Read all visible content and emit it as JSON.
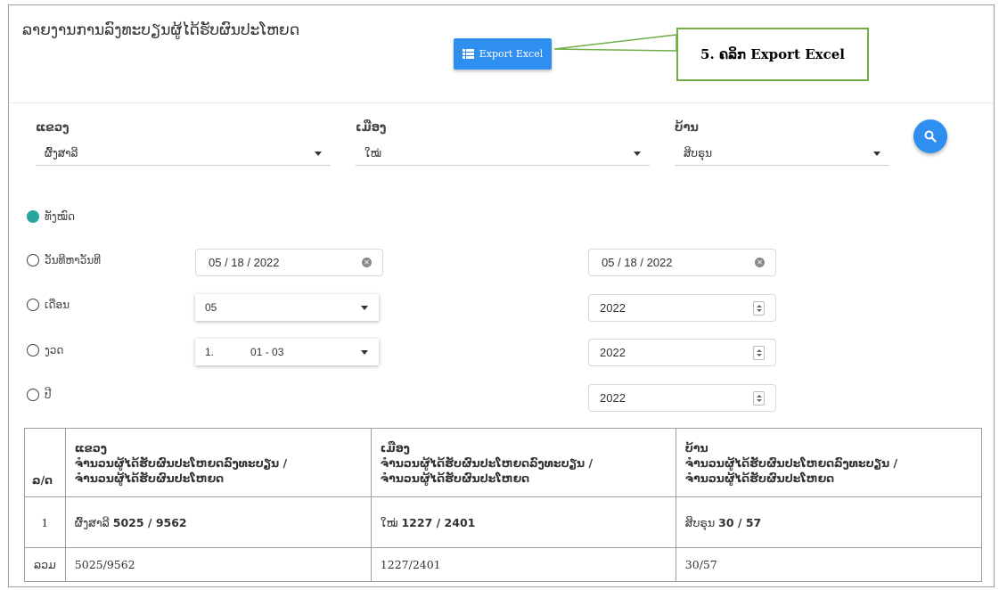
{
  "header": {
    "title": "ລາຍງານການລົງທະບຽນຜູ້ໄດ້ຮັບຜົນປະໂຫຍດ",
    "export_label": "Export Excel",
    "callout": "5. ຄລິກ Export Excel"
  },
  "filters": {
    "province": {
      "label": "ແຂວງ",
      "value": "ຜົ້ງສາລີ"
    },
    "district": {
      "label": "ເມືອງ",
      "value": "ໃໝ່"
    },
    "village": {
      "label": "ບ້ານ",
      "value": "ສິບຣຸນ"
    }
  },
  "period": {
    "all_label": "ທັງໝົດ",
    "date_range_label": "ວັນທີຫາວັນທີ",
    "month_label": "ເດືອນ",
    "quarter_label": "ງວດ",
    "year_label": "ປີ",
    "selected": "all",
    "date_from": "05 / 18 / 2022",
    "date_to": "05 / 18 / 2022",
    "month": "05",
    "month_year": "2022",
    "quarter_no": "1.",
    "quarter_range": "01 - 03",
    "quarter_year": "2022",
    "year": "2022"
  },
  "table": {
    "headers": {
      "index": "ລ/ດ",
      "province": {
        "title": "ແຂວງ",
        "line1": "ຈຳນວນຜູ້ໄດ້ຮັບຜົນປະໂຫຍດລົງທະບຽນ /",
        "line2": "ຈຳນວນຜູ້ໄດ້ຮັບຜົນປະໂຫຍດ"
      },
      "district": {
        "title": "ເມືອງ",
        "line1": "ຈຳນວນຜູ້ໄດ້ຮັບຜົນປະໂຫຍດລົງທະບຽນ /",
        "line2": "ຈຳນວນຜູ້ໄດ້ຮັບຜົນປະໂຫຍດ"
      },
      "village": {
        "title": "ບ້ານ",
        "line1": "ຈຳນວນຜູ້ໄດ້ຮັບຜົນປະໂຫຍດລົງທະບຽນ /",
        "line2": "ຈຳນວນຜູ້ໄດ້ຮັບຜົນປະໂຫຍດ"
      }
    },
    "row": {
      "index": "1",
      "province_name": "ຜົ້ງສາລີ",
      "province_value": "5025 / 9562",
      "district_name": "ໃໝ່",
      "district_value": "1227 / 2401",
      "village_name": "ສິບຣຸນ",
      "village_value": "30 / 57"
    },
    "total": {
      "label": "ລວມ",
      "province": "5025/9562",
      "district": "1227/2401",
      "village": "30/57"
    }
  },
  "colors": {
    "primary": "#2f8ff0",
    "radio_checked": "#26a69a",
    "callout_border": "#70ad47"
  }
}
